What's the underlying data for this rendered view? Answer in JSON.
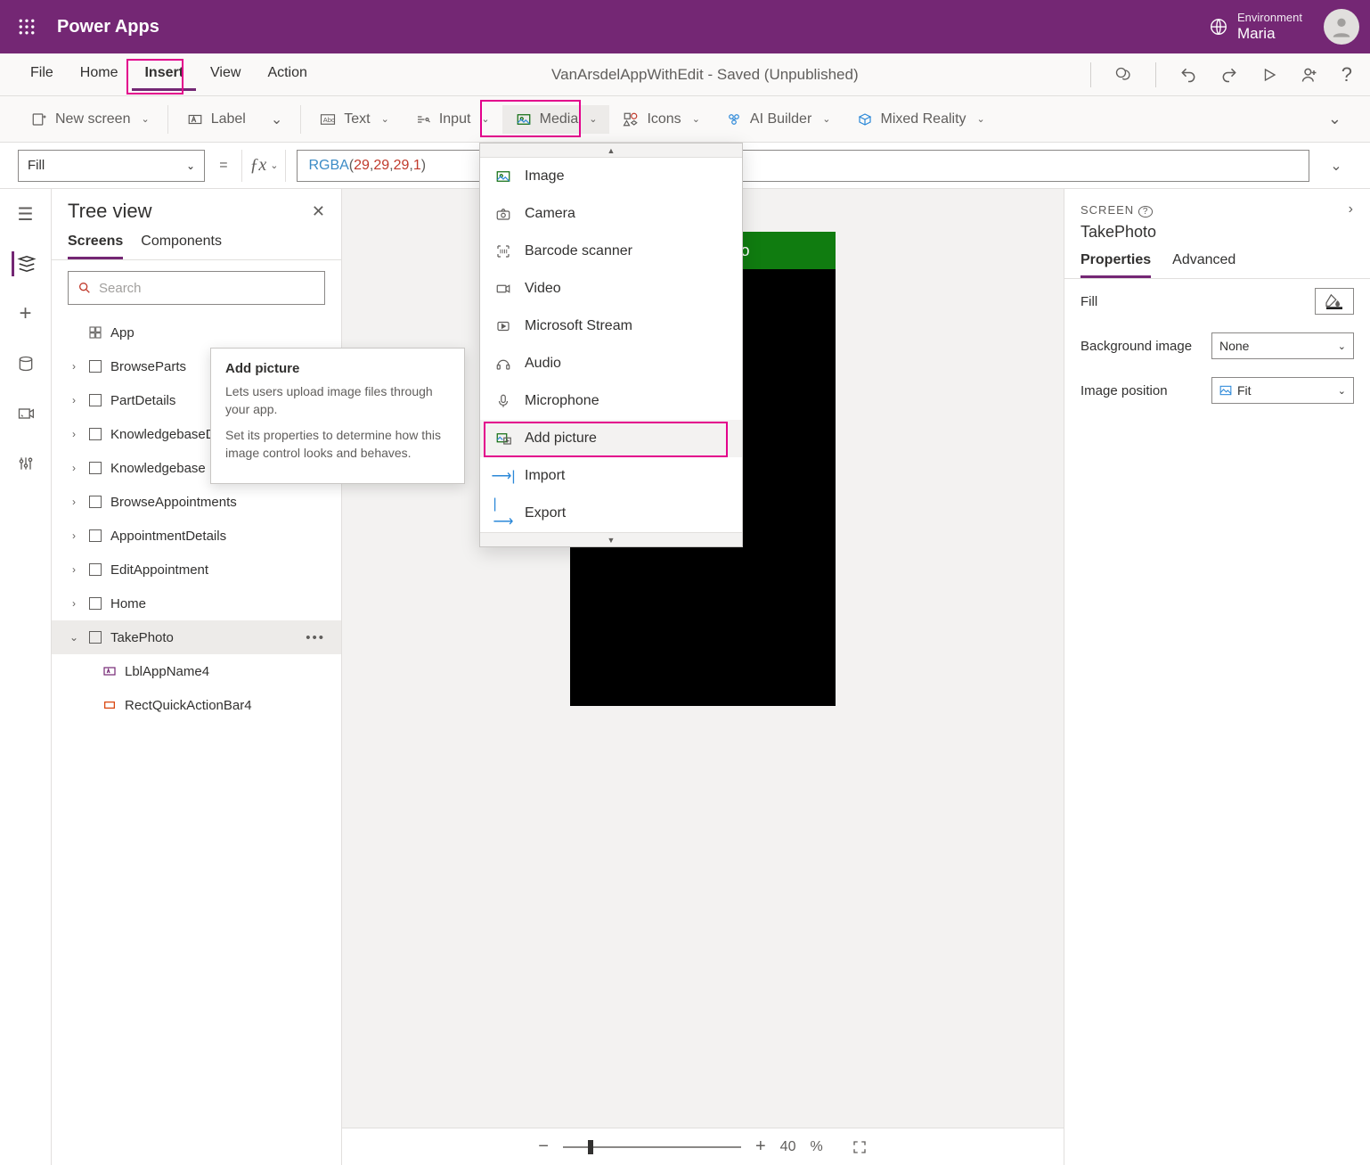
{
  "header": {
    "app_title": "Power Apps",
    "env_label": "Environment",
    "env_value": "Maria"
  },
  "menubar": {
    "items": [
      "File",
      "Home",
      "Insert",
      "View",
      "Action"
    ],
    "active_index": 2,
    "doc_title": "VanArsdelAppWithEdit - Saved (Unpublished)"
  },
  "ribbon": {
    "items": [
      {
        "label": "New screen",
        "icon": "screen-plus-icon"
      },
      {
        "label": "Label",
        "icon": "label-icon"
      },
      {
        "label": "Text",
        "icon": "text-icon"
      },
      {
        "label": "Input",
        "icon": "input-icon"
      },
      {
        "label": "Media",
        "icon": "media-icon"
      },
      {
        "label": "Icons",
        "icon": "icons-icon"
      },
      {
        "label": "AI Builder",
        "icon": "ai-icon"
      },
      {
        "label": "Mixed Reality",
        "icon": "mr-icon"
      }
    ]
  },
  "formula": {
    "property": "Fill",
    "value_fn": "RGBA",
    "value_args": [
      "29",
      "29",
      "29",
      "1"
    ]
  },
  "tree": {
    "title": "Tree view",
    "tabs": [
      "Screens",
      "Components"
    ],
    "active_tab": 0,
    "search_placeholder": "Search",
    "app_label": "App",
    "screens": [
      "BrowseParts",
      "PartDetails",
      "KnowledgebaseDetails",
      "Knowledgebase",
      "BrowseAppointments",
      "AppointmentDetails",
      "EditAppointment",
      "Home",
      "TakePhoto"
    ],
    "selected": "TakePhoto",
    "children": [
      "LblAppName4",
      "RectQuickActionBar4"
    ]
  },
  "canvas": {
    "header_text": "Take a Photo",
    "zoom_value": "40",
    "zoom_unit": "%"
  },
  "dropdown": {
    "items": [
      {
        "label": "Image",
        "icon": "image-icon"
      },
      {
        "label": "Camera",
        "icon": "camera-icon"
      },
      {
        "label": "Barcode scanner",
        "icon": "barcode-icon"
      },
      {
        "label": "Video",
        "icon": "video-icon"
      },
      {
        "label": "Microsoft Stream",
        "icon": "stream-icon"
      },
      {
        "label": "Audio",
        "icon": "audio-icon"
      },
      {
        "label": "Microphone",
        "icon": "mic-icon"
      },
      {
        "label": "Add picture",
        "icon": "add-picture-icon"
      },
      {
        "label": "Import",
        "icon": "import-icon"
      },
      {
        "label": "Export",
        "icon": "export-icon"
      }
    ],
    "hover_index": 7
  },
  "tooltip": {
    "title": "Add picture",
    "line1": "Lets users upload image files through your app.",
    "line2": "Set its properties to determine how this image control looks and behaves."
  },
  "props": {
    "screen_label": "SCREEN",
    "name": "TakePhoto",
    "tabs": [
      "Properties",
      "Advanced"
    ],
    "active_tab": 0,
    "rows": {
      "fill": "Fill",
      "bg": "Background image",
      "bg_val": "None",
      "pos": "Image position",
      "pos_val": "Fit"
    }
  }
}
